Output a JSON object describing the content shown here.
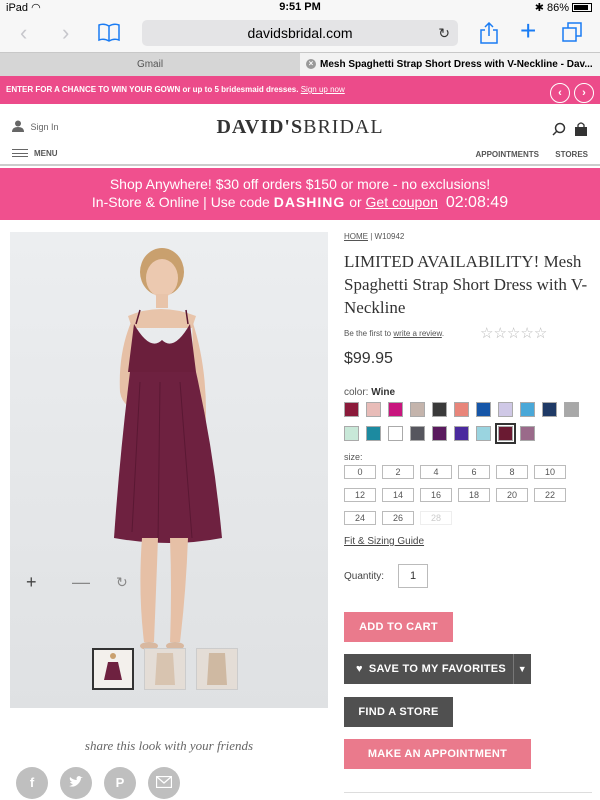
{
  "status_bar": {
    "device": "iPad",
    "time": "9:51 PM",
    "battery": "86%"
  },
  "browser": {
    "url": "davidsbridal.com",
    "tabs": [
      {
        "label": "Gmail"
      },
      {
        "label": "Mesh Spaghetti Strap Short Dress with V-Neckline - Dav..."
      }
    ]
  },
  "promo_top": {
    "text": "ENTER FOR A CHANCE TO WIN YOUR GOWN or up to 5 bridesmaid dresses.",
    "link": "Sign up now"
  },
  "header": {
    "sign_in": "Sign In",
    "logo_a": "DAVID'S",
    "logo_b": "BRIDAL",
    "menu": "MENU",
    "appointments": "APPOINTMENTS",
    "stores": "STORES"
  },
  "banner": {
    "line1": "Shop Anywhere! $30 off orders $150 or more - no exclusions!",
    "line2_prefix": "In-Store & Online | Use code",
    "code": "DASHING",
    "or": "or",
    "coupon": "Get coupon",
    "timer": "02:08:49"
  },
  "breadcrumb": {
    "home": "HOME",
    "sep": "|",
    "sku": "W10942"
  },
  "product": {
    "title": "LIMITED AVAILABILITY! Mesh Spaghetti Strap Short Dress with V-Neckline",
    "review_prefix": "Be the first to",
    "review_link": "write a review",
    "review_suffix": ".",
    "price": "$99.95",
    "color_label": "color:",
    "color_value": "Wine",
    "swatches": [
      "#8b1a3a",
      "#e8bcb8",
      "#c8157e",
      "#c4b4ac",
      "#3a3a3a",
      "#e8857a",
      "#1656a8",
      "#cfc8e6",
      "#4aa8d8",
      "#1f3a66",
      "#a8a8a8",
      "#c8e8d8",
      "#1c8aa0",
      "#ffffff",
      "#56565e",
      "#5a1a5e",
      "#4a2a9e",
      "#9ad4e0",
      "#6a1a32",
      "#9a6a8a"
    ],
    "selected_swatch": 18,
    "size_label": "size:",
    "sizes": [
      "0",
      "2",
      "4",
      "6",
      "8",
      "10",
      "12",
      "14",
      "16",
      "18",
      "20",
      "22",
      "24",
      "26",
      "28"
    ],
    "disabled_sizes": [
      "28"
    ],
    "fit_guide": "Fit & Sizing Guide",
    "quantity_label": "Quantity:",
    "quantity": "1"
  },
  "buttons": {
    "add_to_cart": "ADD TO CART",
    "favorites": "SAVE TO MY FAVORITES",
    "find_store": "FIND A STORE",
    "appointment": "MAKE AN APPOINTMENT"
  },
  "share": {
    "label": "share this look with your friends"
  },
  "social_icons": [
    "facebook-icon",
    "twitter-icon",
    "pinterest-icon",
    "email-icon"
  ]
}
